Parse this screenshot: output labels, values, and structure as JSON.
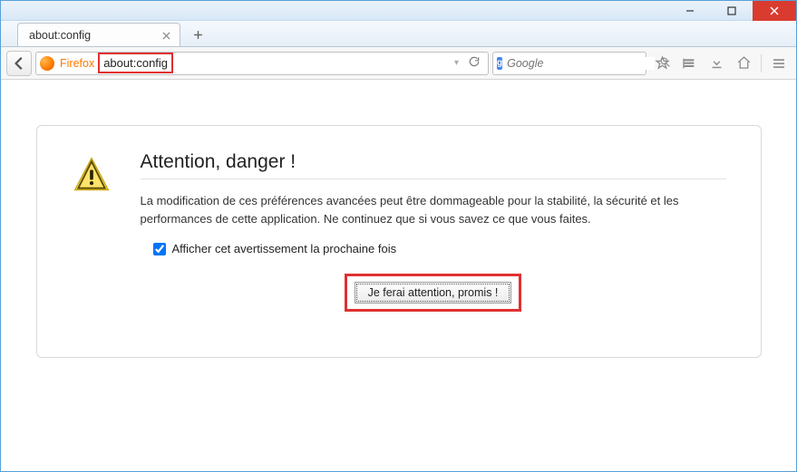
{
  "window": {
    "minimize": "–",
    "maximize": "▢",
    "close": "✕"
  },
  "tab": {
    "title": "about:config"
  },
  "navbar": {
    "identity_label": "Firefox",
    "url": "about:config",
    "search_placeholder": "Google"
  },
  "warning": {
    "title": "Attention, danger !",
    "body": "La modification de ces préférences avancées peut être dommageable pour la stabilité, la sécurité et les performances de cette application. Ne continuez que si vous savez ce que vous faites.",
    "checkbox_label": "Afficher cet avertissement la prochaine fois",
    "button_label": "Je ferai attention, promis !"
  }
}
